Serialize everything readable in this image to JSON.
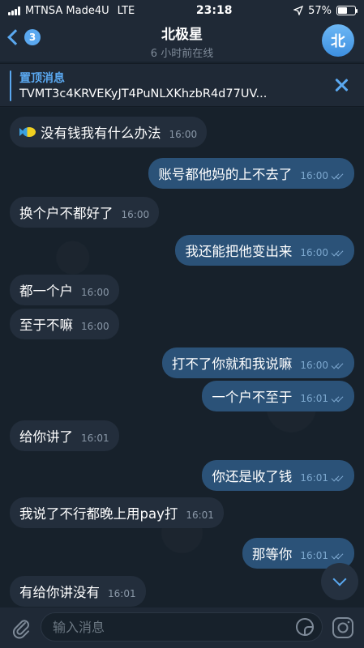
{
  "status_bar": {
    "carrier": "MTNSA Made4U",
    "network": "LTE",
    "time": "23:18",
    "battery": "57%",
    "battery_level": 0.57
  },
  "header": {
    "back_badge": "3",
    "title": "北极星",
    "subtitle": "6 小时前在线",
    "avatar_letter": "北",
    "accent_color": "#5aa8f0"
  },
  "pinned": {
    "title": "置顶消息",
    "text": "TVMT3c4KRVEKyJT4PuNLXKhzbR4d77UV..."
  },
  "messages": [
    {
      "dir": "in",
      "text": "没有钱我有什么办法",
      "time": "16:00",
      "emoji": "fish-icon"
    },
    {
      "dir": "out",
      "text": "账号都他妈的上不去了",
      "time": "16:00"
    },
    {
      "dir": "in",
      "text": "换个户不都好了",
      "time": "16:00"
    },
    {
      "dir": "out",
      "text": "我还能把他变出来",
      "time": "16:00"
    },
    {
      "dir": "in",
      "text": "都一个户",
      "time": "16:00"
    },
    {
      "dir": "in",
      "text": "至于不嘛",
      "time": "16:00"
    },
    {
      "dir": "out",
      "text": "打不了你就和我说嘛",
      "time": "16:00"
    },
    {
      "dir": "out",
      "text": "一个户不至于",
      "time": "16:01"
    },
    {
      "dir": "in",
      "text": "给你讲了",
      "time": "16:01"
    },
    {
      "dir": "out",
      "text": "你还是收了钱",
      "time": "16:01"
    },
    {
      "dir": "in",
      "text": "我说了不行都晚上用pay打",
      "time": "16:01"
    },
    {
      "dir": "out",
      "text": "那等你",
      "time": "16:01"
    },
    {
      "dir": "in",
      "text": "有给你讲没有",
      "time": "16:01"
    }
  ],
  "input": {
    "placeholder": "输入消息"
  }
}
